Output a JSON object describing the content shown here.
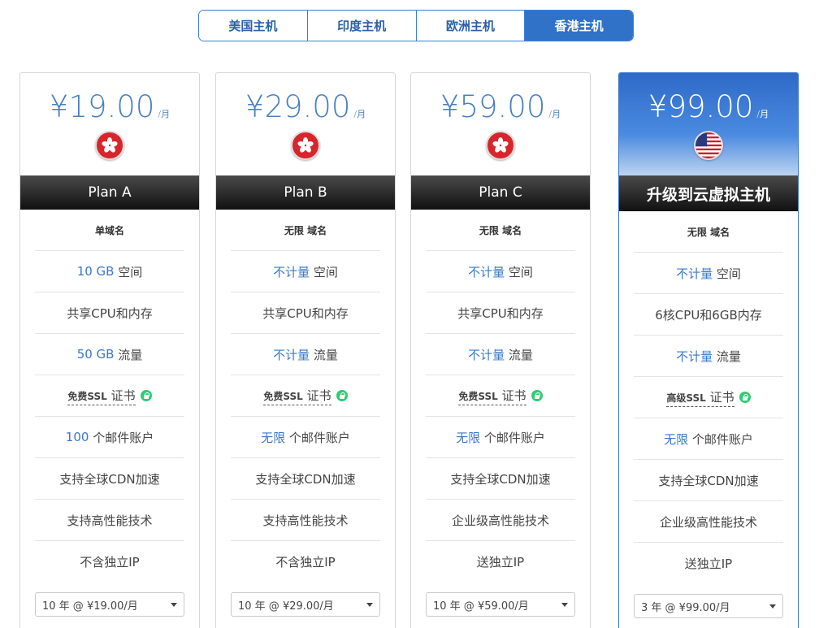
{
  "tabs": [
    {
      "label": "美国主机",
      "active": false
    },
    {
      "label": "印度主机",
      "active": false
    },
    {
      "label": "欧洲主机",
      "active": false
    },
    {
      "label": "香港主机",
      "active": true
    }
  ],
  "plans": [
    {
      "price": "¥19.00",
      "unit": "/月",
      "flag": "hong-kong-flag-icon",
      "name": "Plan A",
      "domain": "单域名",
      "space_hl": "10 GB",
      "space_label": "空间",
      "cpu": "共享CPU和内存",
      "traffic_hl": "50 GB",
      "traffic_label": "流量",
      "ssl_prefix": "免费SSL",
      "ssl_label": "证书",
      "mail_hl": "100",
      "mail_label": "个邮件账户",
      "cdn": "支持全球CDN加速",
      "tech": "支持高性能技术",
      "ip": "不含独立IP",
      "term": "10 年 @ ¥19.00/月"
    },
    {
      "price": "¥29.00",
      "unit": "/月",
      "flag": "hong-kong-flag-icon",
      "name": "Plan B",
      "domain": "无限 域名",
      "space_hl": "不计量",
      "space_label": "空间",
      "cpu": "共享CPU和内存",
      "traffic_hl": "不计量",
      "traffic_label": "流量",
      "ssl_prefix": "免费SSL",
      "ssl_label": "证书",
      "mail_hl": "无限",
      "mail_label": "个邮件账户",
      "cdn": "支持全球CDN加速",
      "tech": "支持高性能技术",
      "ip": "不含独立IP",
      "term": "10 年 @ ¥29.00/月"
    },
    {
      "price": "¥59.00",
      "unit": "/月",
      "flag": "hong-kong-flag-icon",
      "name": "Plan C",
      "domain": "无限 域名",
      "space_hl": "不计量",
      "space_label": "空间",
      "cpu": "共享CPU和内存",
      "traffic_hl": "不计量",
      "traffic_label": "流量",
      "ssl_prefix": "免费SSL",
      "ssl_label": "证书",
      "mail_hl": "无限",
      "mail_label": "个邮件账户",
      "cdn": "支持全球CDN加速",
      "tech": "企业级高性能技术",
      "ip": "送独立IP",
      "term": "10 年 @ ¥59.00/月"
    },
    {
      "price": "¥99.00",
      "unit": "/月",
      "flag": "usa-flag-icon",
      "name": "升级到云虚拟主机",
      "domain": "无限 域名",
      "space_hl": "不计量",
      "space_label": "空间",
      "cpu": "6核CPU和6GB内存",
      "traffic_hl": "不计量",
      "traffic_label": "流量",
      "ssl_prefix": "高级SSL",
      "ssl_label": "证书",
      "mail_hl": "无限",
      "mail_label": "个邮件账户",
      "cdn": "支持全球CDN加速",
      "tech": "企业级高性能技术",
      "ip": "送独立IP",
      "term": "3 年 @ ¥99.00/月"
    }
  ],
  "colors": {
    "accent": "#2f72c8",
    "highlight": "#3a78c9",
    "ssl_lock": "#2ecc71",
    "plan_bar": "#1a1a1a"
  }
}
